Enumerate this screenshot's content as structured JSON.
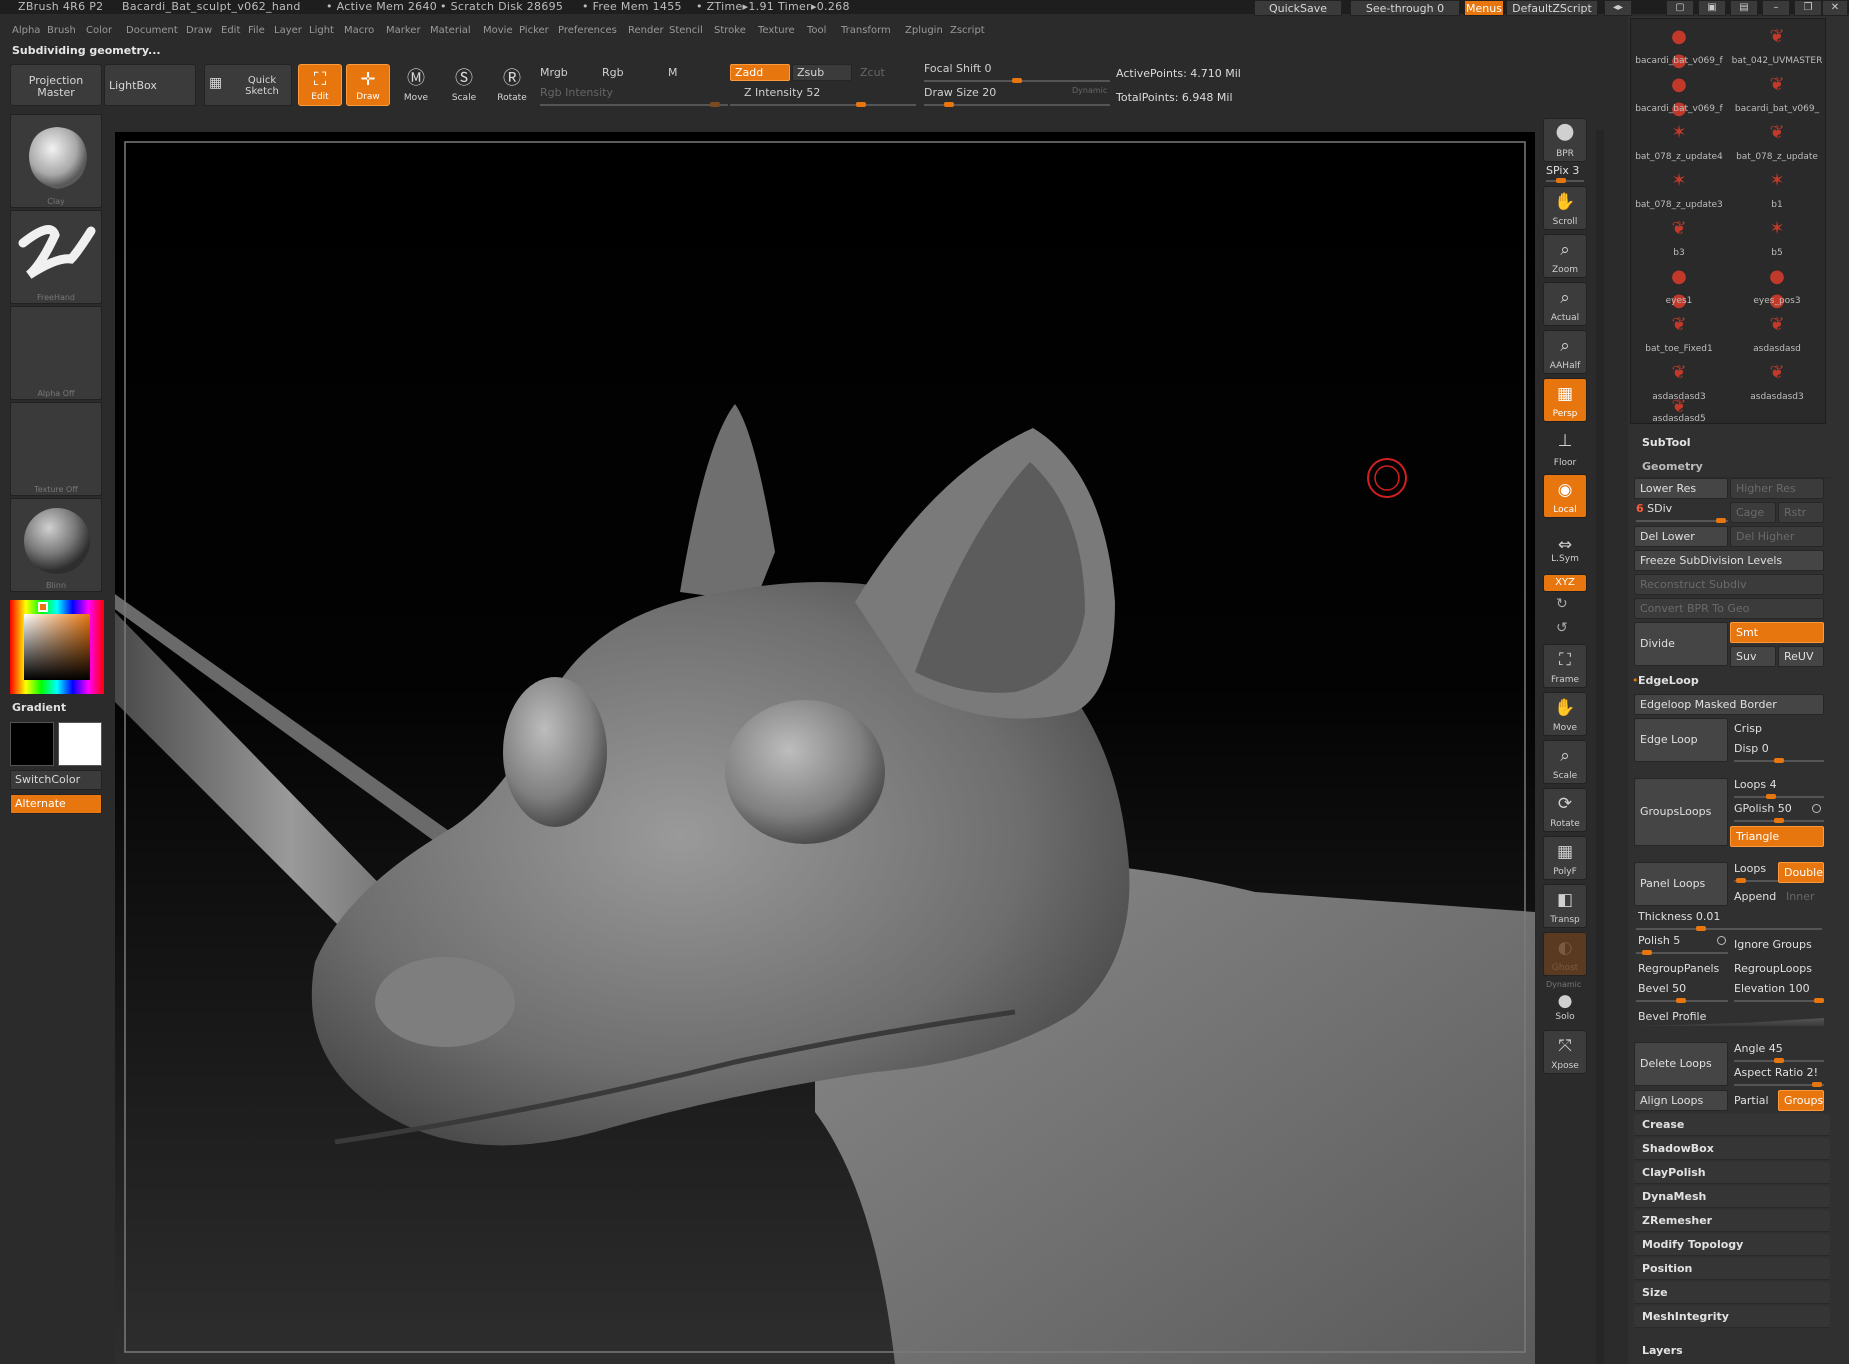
{
  "titlebar": {
    "app": "ZBrush 4R6 P2",
    "document": "Bacardi_Bat_sculpt_v062_hand",
    "active_mem": "• Active Mem 2640",
    "scratch_disk": "• Scratch Disk 28695",
    "free_mem": "• Free Mem 1455",
    "ztime": "• ZTime▸1.91",
    "timer": "Timer▸0.268",
    "quicksave": "QuickSave",
    "see_through": "See-through  0",
    "menus": "Menus",
    "default_zscript": "DefaultZScript"
  },
  "menus": [
    "Alpha",
    "Brush",
    "Color",
    "Document",
    "Draw",
    "Edit",
    "File",
    "Layer",
    "Light",
    "Macro",
    "Marker",
    "Material",
    "Movie",
    "Picker",
    "Preferences",
    "Render",
    "Stencil",
    "Stroke",
    "Texture",
    "Tool",
    "Transform",
    "Zplugin",
    "Zscript"
  ],
  "status": "Subdividing geometry...",
  "shelf": {
    "projection_master": "Projection Master",
    "lightbox": "LightBox",
    "quick_sketch": "Quick Sketch",
    "edit": "Edit",
    "draw": "Draw",
    "move": "Move",
    "scale": "Scale",
    "rotate": "Rotate",
    "mrgb": "Mrgb",
    "rgb": "Rgb",
    "m": "M",
    "rgb_intensity": "Rgb  Intensity",
    "zadd": "Zadd",
    "zsub": "Zsub",
    "zcut": "Zcut",
    "z_intensity": "Z Intensity 52",
    "z_intensity_value": 52,
    "focal_shift": "Focal Shift 0",
    "draw_size": "Draw Size 20",
    "dynamic": "Dynamic",
    "active_points": "ActivePoints: 4.710  Mil",
    "total_points": "TotalPoints: 6.948  Mil"
  },
  "left": {
    "brush": "Clay",
    "stroke": "FreeHand",
    "alpha": "Alpha Off",
    "texture": "Texture Off",
    "material": "Blinn",
    "gradient": "Gradient",
    "switch_color": "SwitchColor",
    "alternate": "Alternate"
  },
  "rightshelf": {
    "bpr": "BPR",
    "spix": "SPix 3",
    "scroll": "Scroll",
    "zoom": "Zoom",
    "actual": "Actual",
    "aahalf": "AAHalf",
    "persp": "Persp",
    "floor": "Floor",
    "local": "Local",
    "lsym": "L.Sym",
    "xyz": "XYZ",
    "frame": "Frame",
    "move": "Move",
    "scale": "Scale",
    "rotate": "Rotate",
    "polyf": "PolyF",
    "transp": "Transp",
    "ghost": "Ghost",
    "dynamic": "Dynamic",
    "solo": "Solo",
    "xpose": "Xpose"
  },
  "subtools": [
    "bacardi_bat_v069_f",
    "bat_042_UVMASTER",
    "bacardi_bat_v069_f",
    "bacardi_bat_v069_",
    "bat_078_z_update4",
    "bat_078_z_update",
    "bat_078_z_update3",
    "b1",
    "b3",
    "b5",
    "eyes1",
    "eyes_pos3",
    "bat_toe_Fixed1",
    "asdasdasd",
    "asdasdasd3",
    "asdasdasd3",
    "asdasdasd5"
  ],
  "panel": {
    "subtool": "SubTool",
    "geometry": "Geometry",
    "lower_res": "Lower Res",
    "higher_res": "Higher Res",
    "sdiv": "SDiv",
    "sdiv_value": "6",
    "cage": "Cage",
    "rstr": "Rstr",
    "del_lower": "Del Lower",
    "del_higher": "Del Higher",
    "freeze": "Freeze SubDivision Levels",
    "reconstruct": "Reconstruct Subdiv",
    "convert_bpr": "Convert BPR To Geo",
    "divide": "Divide",
    "smt": "Smt",
    "suv": "Suv",
    "reuv": "ReUV",
    "edgeloop": "EdgeLoop",
    "edgeloop_masked": "Edgeloop Masked Border",
    "edge_loop": "Edge Loop",
    "crisp": "Crisp",
    "disp": "Disp 0",
    "groupsloops": "GroupsLoops",
    "loops4": "Loops 4",
    "gpolish": "GPolish 50",
    "triangle": "Triangle",
    "panel_loops": "Panel Loops",
    "loops": "Loops",
    "double": "Double",
    "append": "Append",
    "inner": "Inner",
    "thickness": "Thickness 0.01",
    "polish": "Polish 5",
    "ignore_groups": "Ignore Groups",
    "regroup_panels": "RegroupPanels",
    "regroup_loops": "RegroupLoops",
    "bevel": "Bevel 50",
    "elevation": "Elevation 100",
    "bevel_profile": "Bevel Profile",
    "delete_loops": "Delete Loops",
    "angle": "Angle 45",
    "aspect_ratio": "Aspect Ratio 2!",
    "align_loops": "Align Loops",
    "partial": "Partial",
    "groups": "Groups",
    "crease": "Crease",
    "shadowbox": "ShadowBox",
    "claypolish": "ClayPolish",
    "dynamesh": "DynaMesh",
    "zremesher": "ZRemesher",
    "modify_topology": "Modify Topology",
    "position": "Position",
    "size": "Size",
    "meshintegrity": "MeshIntegrity",
    "layers": "Layers"
  },
  "colors": {
    "accent": "#e8760e",
    "background": "#2b2b2b"
  }
}
